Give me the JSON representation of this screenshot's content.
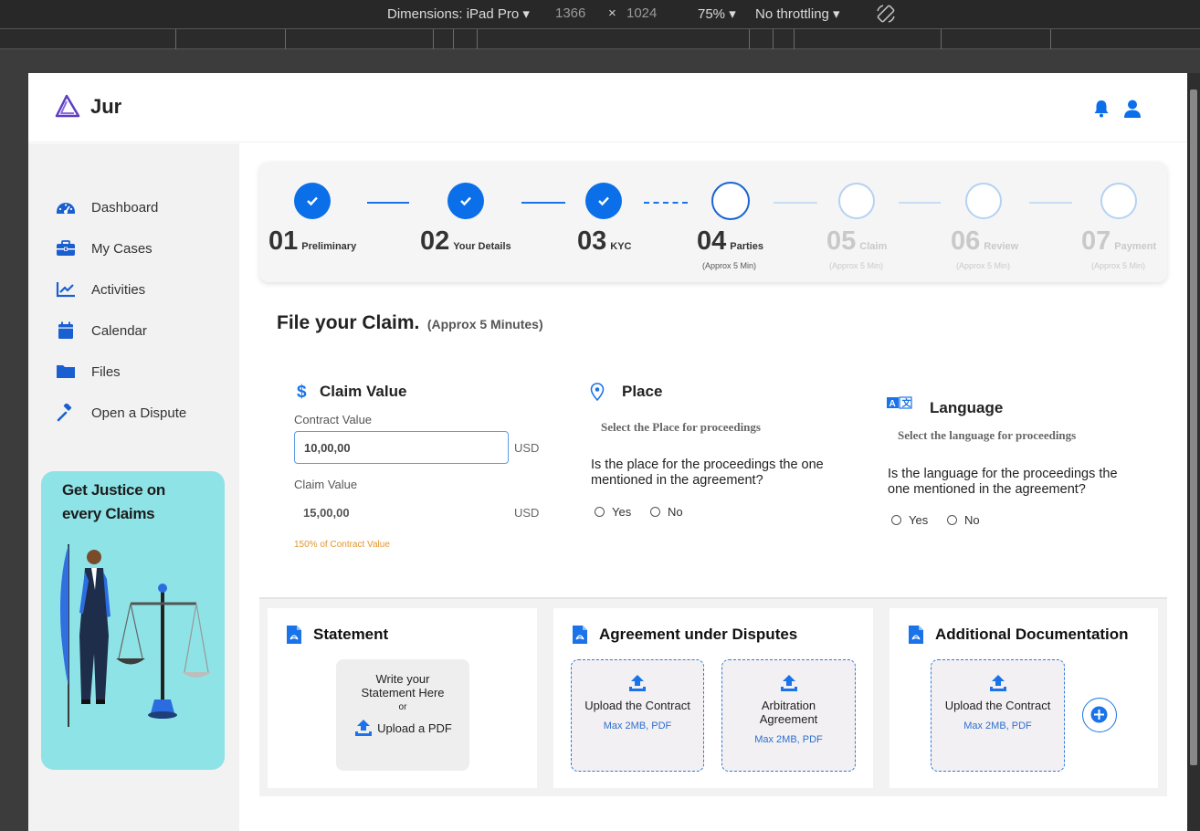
{
  "devtools": {
    "dimensions": "Dimensions: iPad Pro",
    "width": "1366",
    "times": "×",
    "height": "1024",
    "zoom": "75%",
    "throttling": "No throttling"
  },
  "header": {
    "brand": "Jur"
  },
  "sidebar": {
    "items": [
      {
        "label": "Dashboard",
        "icon": "dashboard-icon"
      },
      {
        "label": "My Cases",
        "icon": "briefcase-icon"
      },
      {
        "label": "Activities",
        "icon": "chart-line-icon"
      },
      {
        "label": "Calendar",
        "icon": "calendar-icon"
      },
      {
        "label": "Files",
        "icon": "folder-icon"
      },
      {
        "label": "Open a Dispute",
        "icon": "gavel-icon"
      }
    ],
    "promo": "Get Justice on every Claims"
  },
  "stepper": {
    "steps": [
      {
        "num": "01",
        "title": "Preliminary",
        "sub": "",
        "state": "done"
      },
      {
        "num": "02",
        "title": "Your Details",
        "sub": "",
        "state": "done"
      },
      {
        "num": "03",
        "title": "KYC",
        "sub": "",
        "state": "done"
      },
      {
        "num": "04",
        "title": "Parties",
        "sub": "(Approx 5 Min)",
        "state": "current"
      },
      {
        "num": "05",
        "title": "Claim",
        "sub": "(Approx 5 Min)",
        "state": "future"
      },
      {
        "num": "06",
        "title": "Review",
        "sub": "(Approx 5 Min)",
        "state": "future"
      },
      {
        "num": "07",
        "title": "Payment",
        "sub": "(Approx 5 Min)",
        "state": "future"
      }
    ]
  },
  "page": {
    "title": "File your Claim.",
    "subtitle": "(Approx 5 Minutes)"
  },
  "claim": {
    "heading": "Claim Value",
    "contract_label": "Contract Value",
    "contract_value": "10,00,00",
    "contract_unit": "USD",
    "claim_label": "Claim Value",
    "claim_value": "15,00,00",
    "claim_unit": "USD",
    "hint": "150% of Contract Value"
  },
  "place": {
    "heading": "Place",
    "sub": "Select the Place for proceedings",
    "question": "Is the place for the proceedings the one mentioned in the agreement?",
    "yes": "Yes",
    "no": "No"
  },
  "language": {
    "heading": "Language",
    "sub": "Select the language for proceedings",
    "question": "Is the language for the proceedings the one mentioned in the agreement?",
    "yes": "Yes",
    "no": "No"
  },
  "documents": {
    "statement": {
      "heading": "Statement",
      "write": "Write your Statement Here",
      "or": "or",
      "upload": "Upload a PDF"
    },
    "agreement": {
      "heading": "Agreement under Disputes",
      "upload_contract": "Upload the Contract",
      "upload_contract_hint": "Max 2MB, PDF",
      "arbitration": "Arbitration Agreement",
      "arbitration_hint": "Max 2MB, PDF"
    },
    "additional": {
      "heading": "Additional Documentation",
      "upload_contract": "Upload the Contract",
      "upload_contract_hint": "Max 2MB, PDF"
    }
  },
  "colors": {
    "accent": "#1a73e8",
    "promo_bg": "#8ee3e6",
    "hint": "#e0962f"
  }
}
